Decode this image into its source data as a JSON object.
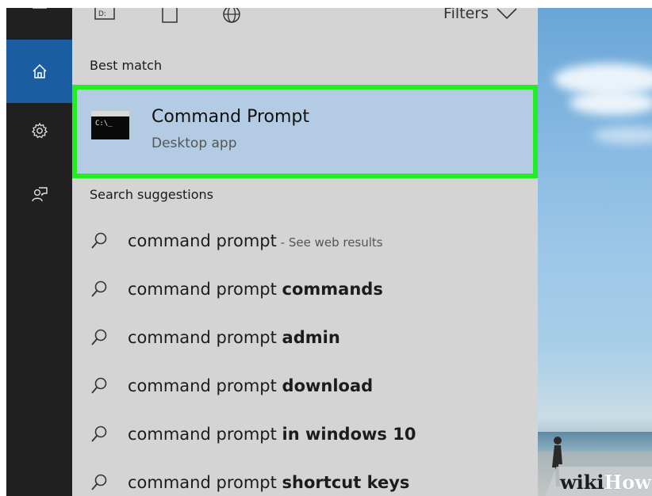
{
  "top_bar": {
    "filters_label": "Filters"
  },
  "sections": {
    "best_match_label": "Best match",
    "suggestions_label": "Search suggestions"
  },
  "best_match": {
    "title": "Command Prompt",
    "subtitle": "Desktop app",
    "icon_text": "C:\\_",
    "highlight_color": "#22ee22"
  },
  "suggestions": [
    {
      "prefix": "command prompt",
      "suffix": "",
      "hint": " - See web results"
    },
    {
      "prefix": "command prompt ",
      "suffix": "commands",
      "hint": ""
    },
    {
      "prefix": "command prompt ",
      "suffix": "admin",
      "hint": ""
    },
    {
      "prefix": "command prompt ",
      "suffix": "download",
      "hint": ""
    },
    {
      "prefix": "command prompt ",
      "suffix": "in windows 10",
      "hint": ""
    },
    {
      "prefix": "command prompt ",
      "suffix": "shortcut keys",
      "hint": ""
    }
  ],
  "watermark": {
    "part1": "wiki",
    "part2": "How"
  },
  "colors": {
    "rail_bg": "#202020",
    "rail_active": "#1a5ea1",
    "panel_bg": "#d4d4d4",
    "selection_bg": "#b3cce3"
  }
}
